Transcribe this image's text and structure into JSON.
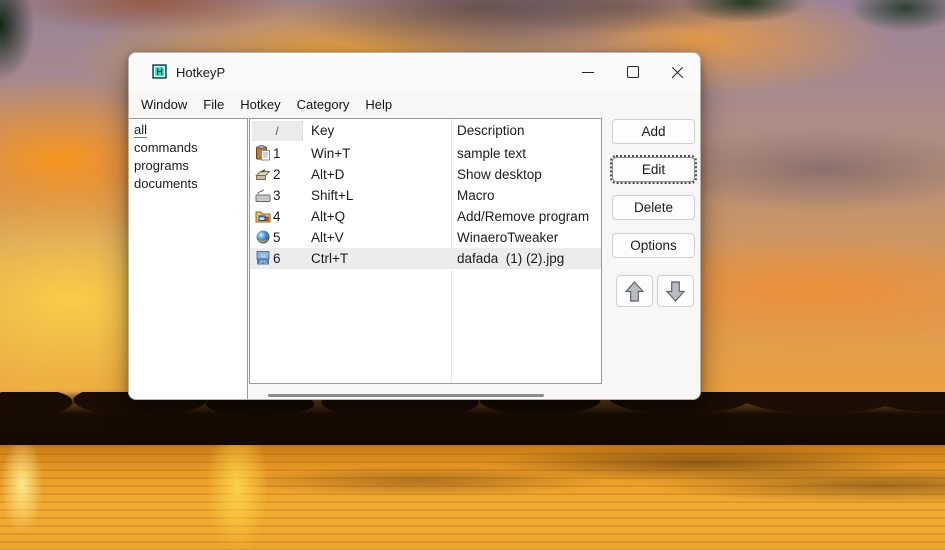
{
  "window": {
    "title": "HotkeyP",
    "icon_letter": "H",
    "controls": [
      "minimize-icon",
      "maximize-icon",
      "close-icon"
    ]
  },
  "menu_bar": {
    "items": [
      "Window",
      "File",
      "Hotkey",
      "Category",
      "Help"
    ]
  },
  "category_list": {
    "items": [
      "all",
      "commands",
      "programs",
      "documents"
    ],
    "selected": "all"
  },
  "hotkey_list": {
    "sort_column_header": "/",
    "key_column_header": "Key",
    "description_column_header": "Description",
    "rows": [
      {
        "icon": "paste-clipboard-icon",
        "index": "1",
        "key": "Win+T",
        "description": "sample text"
      },
      {
        "icon": "show-desktop-icon",
        "index": "2",
        "key": "Alt+D",
        "description": "Show desktop"
      },
      {
        "icon": "keyboard-macro-icon",
        "index": "3",
        "key": "Shift+L",
        "description": "Macro"
      },
      {
        "icon": "programs-folder-icon",
        "index": "4",
        "key": "Alt+Q",
        "description": "Add/Remove program"
      },
      {
        "icon": "winaero-tweaker-icon",
        "index": "5",
        "key": "Alt+V",
        "description": "WinaeroTweaker"
      },
      {
        "icon": "jpg-image-icon",
        "index": "6",
        "key": "Ctrl+T",
        "description": "dafada  (1) (2).jpg"
      }
    ],
    "selected_row_index": "6"
  },
  "action_buttons": {
    "add": "Add",
    "edit": "Edit",
    "delete": "Delete",
    "options": "Options",
    "move_up": "up-arrow-icon",
    "move_down": "down-arrow-icon"
  },
  "colors": {
    "selected_row": "#ececec",
    "window_bg": "#f8f7f6",
    "panel_border": "#9a9a9a",
    "app_icon_teal": "#3fe0c8",
    "scrollbar_thumb": "#8a8a8a"
  }
}
